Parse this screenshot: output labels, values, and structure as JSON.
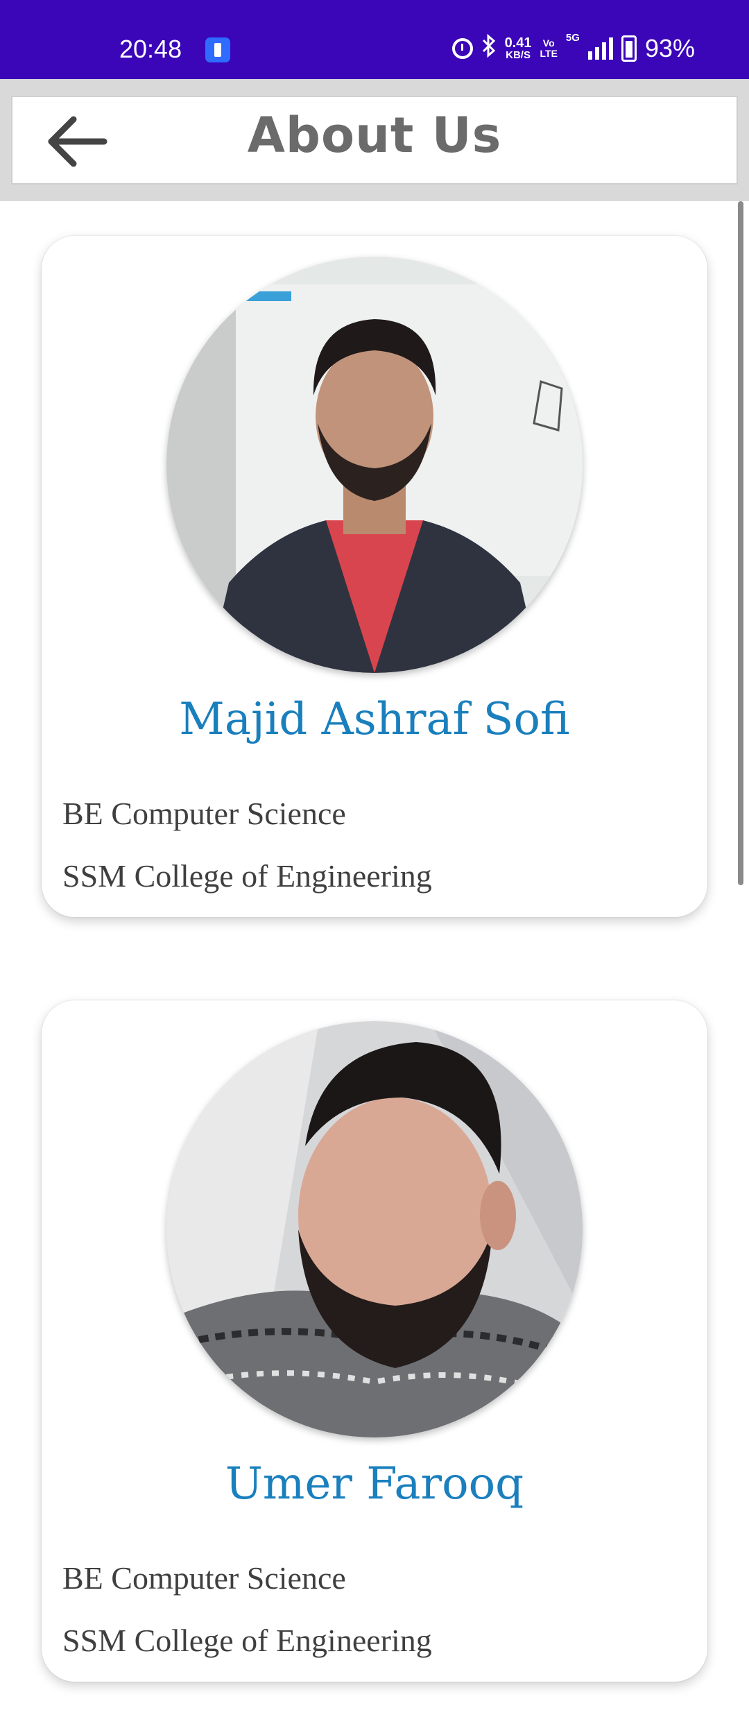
{
  "status_bar": {
    "time": "20:48",
    "net_speed_value": "0.41",
    "net_speed_unit": "KB/S",
    "volte_top": "Vo",
    "volte_bottom": "LTE",
    "network": "5G",
    "battery": "93%"
  },
  "app_bar": {
    "title": "About Us",
    "back_icon": "arrow-left-icon"
  },
  "members": [
    {
      "name": "Majid Ashraf Sofi",
      "degree": "BE Computer Science",
      "college": "SSM College of Engineering"
    },
    {
      "name": "Umer Farooq",
      "degree": "BE Computer Science",
      "college": "SSM College of Engineering"
    }
  ],
  "colors": {
    "status_bar": "#3a06b8",
    "name_accent": "#1a7fbd",
    "title_gray": "#6b6b6b"
  }
}
